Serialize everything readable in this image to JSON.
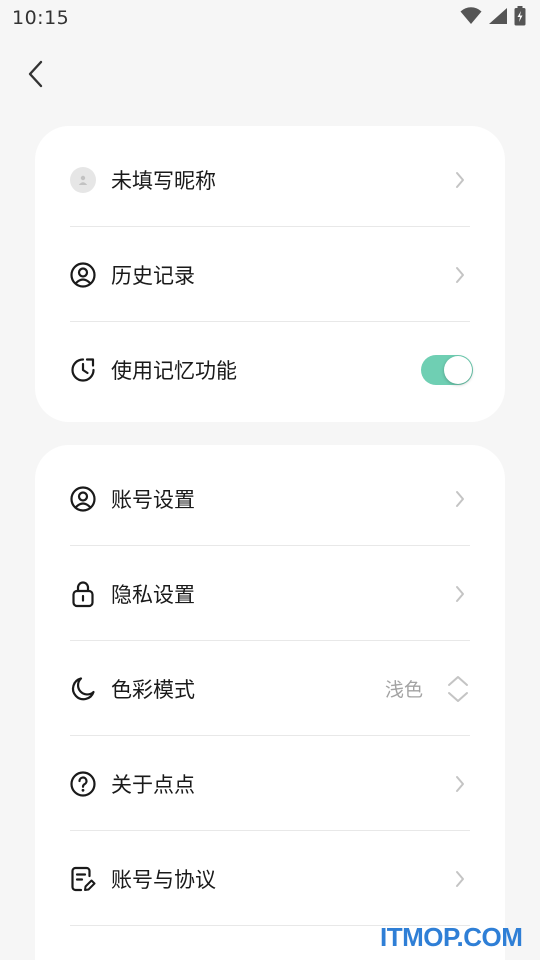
{
  "status_bar": {
    "time": "10:15",
    "icons": [
      "wifi-icon",
      "signal-icon",
      "battery-icon"
    ]
  },
  "nav": {
    "back_icon": "chevron-left-icon"
  },
  "group1": {
    "items": [
      {
        "label": "未填写昵称",
        "icon": "avatar-icon"
      },
      {
        "label": "历史记录",
        "icon": "user-circle-icon"
      },
      {
        "label": "使用记忆功能",
        "icon": "clock-memory-icon",
        "toggle_on": true
      }
    ]
  },
  "group2": {
    "items": [
      {
        "label": "账号设置",
        "icon": "user-circle-icon"
      },
      {
        "label": "隐私设置",
        "icon": "lock-icon"
      },
      {
        "label": "色彩模式",
        "icon": "moon-icon",
        "value": "浅色"
      },
      {
        "label": "关于点点",
        "icon": "question-icon"
      },
      {
        "label": "账号与协议",
        "icon": "document-edit-icon"
      }
    ]
  },
  "colors": {
    "background": "#f6f6f6",
    "card": "#ffffff",
    "toggle_on": "#6fcfb3",
    "chevron": "#c4c4c4",
    "value_text": "#a3a3a3",
    "watermark": "#2f7fd6"
  },
  "watermark": "ITMOP.COM"
}
